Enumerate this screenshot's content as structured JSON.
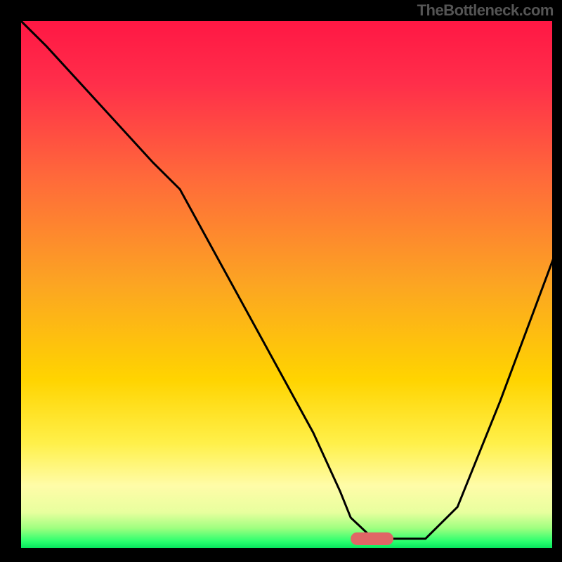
{
  "watermark": "TheBottleneck.com",
  "chart_data": {
    "type": "line",
    "title": "",
    "xlabel": "",
    "ylabel": "",
    "xlim": [
      0,
      100
    ],
    "ylim": [
      0,
      100
    ],
    "grid": false,
    "gradient_stops": [
      {
        "offset": 0.0,
        "color": "#ff1744"
      },
      {
        "offset": 0.12,
        "color": "#ff2e4a"
      },
      {
        "offset": 0.3,
        "color": "#ff6a3a"
      },
      {
        "offset": 0.5,
        "color": "#fca522"
      },
      {
        "offset": 0.68,
        "color": "#ffd400"
      },
      {
        "offset": 0.8,
        "color": "#fff04a"
      },
      {
        "offset": 0.88,
        "color": "#fffca8"
      },
      {
        "offset": 0.93,
        "color": "#e8ff9e"
      },
      {
        "offset": 0.96,
        "color": "#9fff80"
      },
      {
        "offset": 0.985,
        "color": "#2aff6e"
      },
      {
        "offset": 1.0,
        "color": "#00e05a"
      }
    ],
    "series": [
      {
        "name": "bottleneck-curve",
        "type": "line",
        "color": "#000000",
        "x": [
          0,
          5,
          15,
          25,
          30,
          55,
          60,
          62,
          66,
          70,
          76,
          82,
          90,
          100
        ],
        "y": [
          100,
          95,
          84,
          73,
          68,
          22,
          11,
          6,
          2.2,
          2,
          2,
          8,
          28,
          55
        ]
      }
    ],
    "marker": {
      "name": "optimal-marker",
      "shape": "pill",
      "color": "#e06666",
      "x_center": 66,
      "y": 2,
      "width_x_units": 8,
      "height_y_units": 2.4
    }
  }
}
